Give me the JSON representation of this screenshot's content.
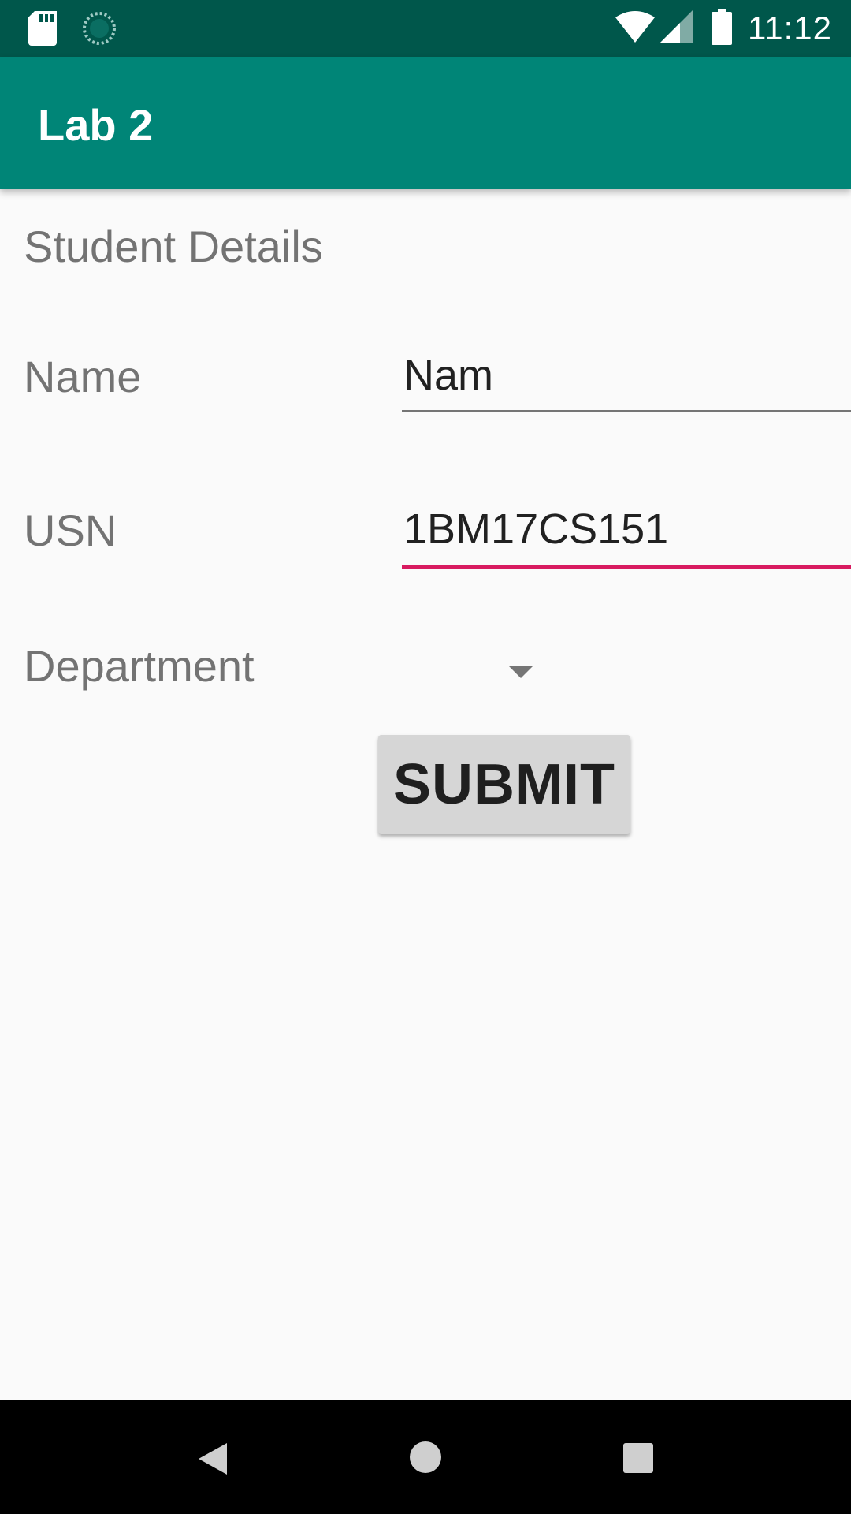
{
  "status_bar": {
    "time": "11:12",
    "icons": [
      "sd-card-icon",
      "sync-icon",
      "wifi-icon",
      "signal-icon",
      "battery-icon"
    ]
  },
  "app_bar": {
    "title": "Lab 2"
  },
  "form": {
    "heading": "Student Details",
    "name_label": "Name",
    "name_value": "Nam",
    "usn_label": "USN",
    "usn_value": "1BM17CS151",
    "department_label": "Department",
    "submit_label": "SUBMIT"
  },
  "colors": {
    "status_bar": "#00574b",
    "app_bar": "#008577",
    "accent": "#d81b60",
    "background": "#fafafa"
  },
  "nav_bar": {
    "icons": [
      "back-icon",
      "home-icon",
      "recents-icon"
    ]
  }
}
